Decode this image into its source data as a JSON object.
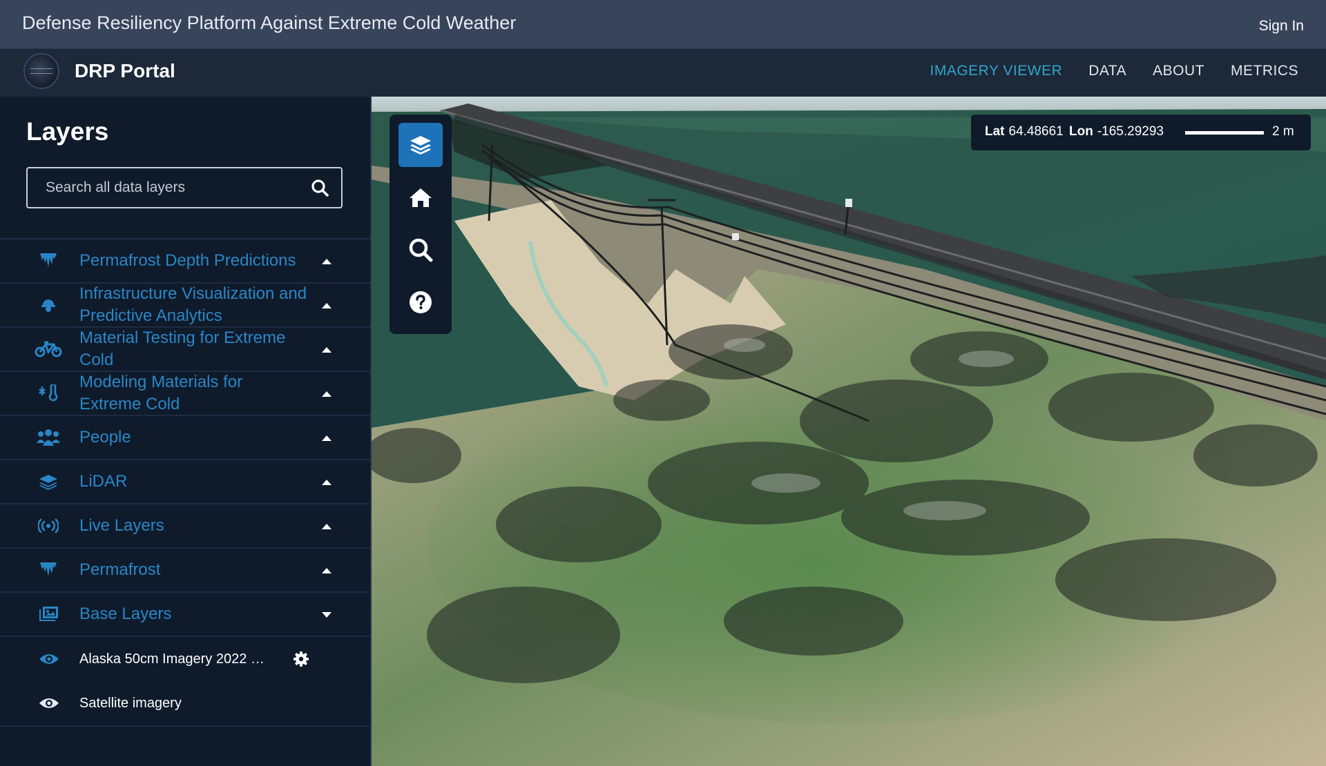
{
  "banner": {
    "title": "Defense Resiliency Platform Against Extreme Cold Weather",
    "sign_in": "Sign In"
  },
  "navbar": {
    "brand": "DRP Portal",
    "links": [
      {
        "label": "IMAGERY VIEWER",
        "active": true
      },
      {
        "label": "DATA",
        "active": false
      },
      {
        "label": "ABOUT",
        "active": false
      },
      {
        "label": "METRICS",
        "active": false
      }
    ]
  },
  "sidebar": {
    "title": "Layers",
    "search": {
      "placeholder": "Search all data layers",
      "value": ""
    },
    "layers": [
      {
        "label": "Permafrost Depth Predictions",
        "icon": "icicles-icon",
        "state": "collapsed"
      },
      {
        "label": "Infrastructure Visualization and Predictive Analytics",
        "icon": "hard-hat-icon",
        "state": "collapsed"
      },
      {
        "label": "Material Testing for Extreme Cold",
        "icon": "bicycle-icon",
        "state": "collapsed"
      },
      {
        "label": "Modeling Materials for Extreme Cold",
        "icon": "temperature-low-icon",
        "state": "collapsed"
      },
      {
        "label": "People",
        "icon": "users-icon",
        "state": "collapsed"
      },
      {
        "label": "LiDAR",
        "icon": "layer-group-icon",
        "state": "collapsed"
      },
      {
        "label": "Live Layers",
        "icon": "broadcast-icon",
        "state": "collapsed"
      },
      {
        "label": "Permafrost",
        "icon": "icicles-icon",
        "state": "collapsed"
      },
      {
        "label": "Base Layers",
        "icon": "images-icon",
        "state": "expanded"
      }
    ],
    "base_layers": [
      {
        "label": "Alaska 50cm Imagery 2022 …",
        "visible": true,
        "has_settings": true,
        "eye_color": "#2a86c6"
      },
      {
        "label": "Satellite imagery",
        "visible": true,
        "has_settings": false,
        "eye_color": "#e6ebf2"
      }
    ]
  },
  "map": {
    "tools": [
      "layers-icon",
      "home-icon",
      "search-icon",
      "help-icon"
    ],
    "coords": {
      "lat_label": "Lat",
      "lat": "64.48661",
      "lon_label": "Lon",
      "lon": "-165.29293",
      "scale": "2 m"
    }
  },
  "colors": {
    "accent": "#2fa6c8",
    "layer_label": "#2a86c6",
    "sidebar_bg": "#0f1b2b",
    "banner_bg": "#37445a",
    "navbar_bg": "#1d2838",
    "tool_active": "#1e73b8"
  }
}
